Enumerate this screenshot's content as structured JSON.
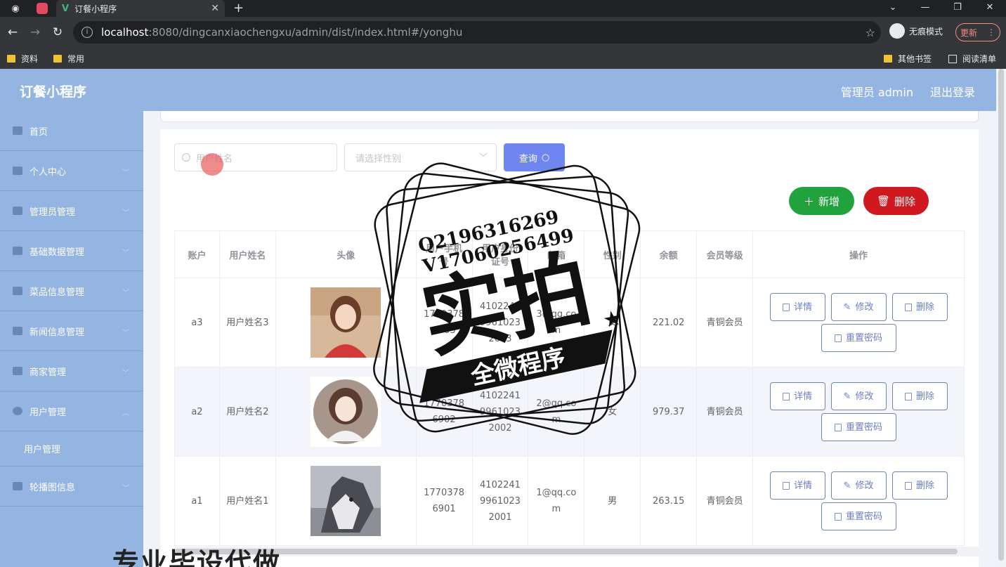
{
  "browser": {
    "tab_title": "订餐小程序",
    "tab_close": "✕",
    "new_tab": "+",
    "url_host": "localhost",
    "url_rest": ":8080/dingcanxiaochengxu/admin/dist/index.html#/yonghu",
    "incognito_label": "无痕模式",
    "update_label": "更新",
    "bookmarks": [
      "资料",
      "常用"
    ],
    "bookmarks_right": [
      "其他书签",
      "阅读清单"
    ]
  },
  "header": {
    "app_title": "订餐小程序",
    "user_label": "管理员 admin",
    "logout_label": "退出登录"
  },
  "sidebar": {
    "items": [
      {
        "label": "首页"
      },
      {
        "label": "个人中心"
      },
      {
        "label": "管理员管理"
      },
      {
        "label": "基础数据管理"
      },
      {
        "label": "菜品信息管理"
      },
      {
        "label": "新闻信息管理"
      },
      {
        "label": "商家管理"
      },
      {
        "label": "用户管理"
      },
      {
        "label": "用户管理"
      },
      {
        "label": "轮播图信息"
      }
    ]
  },
  "search": {
    "name_placeholder": "用户姓名",
    "gender_placeholder": "请选择性别",
    "query_label": "查询"
  },
  "actions": {
    "add_label": "新增",
    "delete_label": "删除"
  },
  "table": {
    "headers": [
      "账户",
      "用户姓名",
      "头像",
      "用户手机号",
      "用户身份证号",
      "邮箱",
      "性别",
      "余额",
      "会员等级",
      "操作"
    ],
    "rows": [
      {
        "account": "a3",
        "name": "用户姓名3",
        "phone": "17703786903",
        "idcard": "410224199610232003",
        "email": "3@qq.com",
        "gender": "女",
        "balance": "221.02",
        "level": "青铜会员"
      },
      {
        "account": "a2",
        "name": "用户姓名2",
        "phone": "17703786902",
        "idcard": "410224199610232002",
        "email": "2@qq.com",
        "gender": "女",
        "balance": "979.37",
        "level": "青铜会员"
      },
      {
        "account": "a1",
        "name": "用户姓名1",
        "phone": "17703786901",
        "idcard": "410224199610232001",
        "email": "1@qq.com",
        "gender": "男",
        "balance": "263.15",
        "level": "青铜会员"
      }
    ],
    "op_detail": "详情",
    "op_edit": "修改",
    "op_delete": "删除",
    "op_reset": "重置密码"
  },
  "watermark": {
    "qq": "Q2196316269",
    "vx": "V17060256499",
    "big": "实拍",
    "ribbon": "全微程序",
    "bottom_text": "专业毕设代做"
  }
}
